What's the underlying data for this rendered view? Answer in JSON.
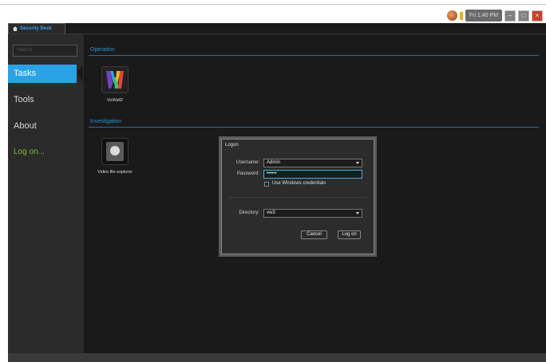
{
  "tray": {
    "clock": "Fri 1:40 PM"
  },
  "app": {
    "tab_label": "Security Desk"
  },
  "sidebar": {
    "search_placeholder": "Search",
    "items": [
      {
        "label": "Tasks",
        "active": true
      },
      {
        "label": "Tools"
      },
      {
        "label": "About"
      },
      {
        "label": "Log on..."
      }
    ]
  },
  "main": {
    "sections": [
      {
        "title": "Operation",
        "tiles": [
          {
            "label": "VuWall2"
          }
        ]
      },
      {
        "title": "Investigation",
        "tiles": [
          {
            "label": "Video file explorer"
          }
        ]
      }
    ]
  },
  "logon_dialog": {
    "title": "Logon",
    "username_label": "Username:",
    "username_value": "Admin",
    "password_label": "Password:",
    "password_value": "••••••",
    "windows_credentials_label": "Use Windows credentials",
    "directory_label": "Directory:",
    "directory_value": "vw3",
    "cancel_label": "Cancel",
    "logon_label": "Log on"
  },
  "colors": {
    "accent_blue": "#2aa2e6",
    "logon_green": "#7fbd3a",
    "background": "#1a1a1a",
    "sidebar": "#2b2b2b"
  }
}
